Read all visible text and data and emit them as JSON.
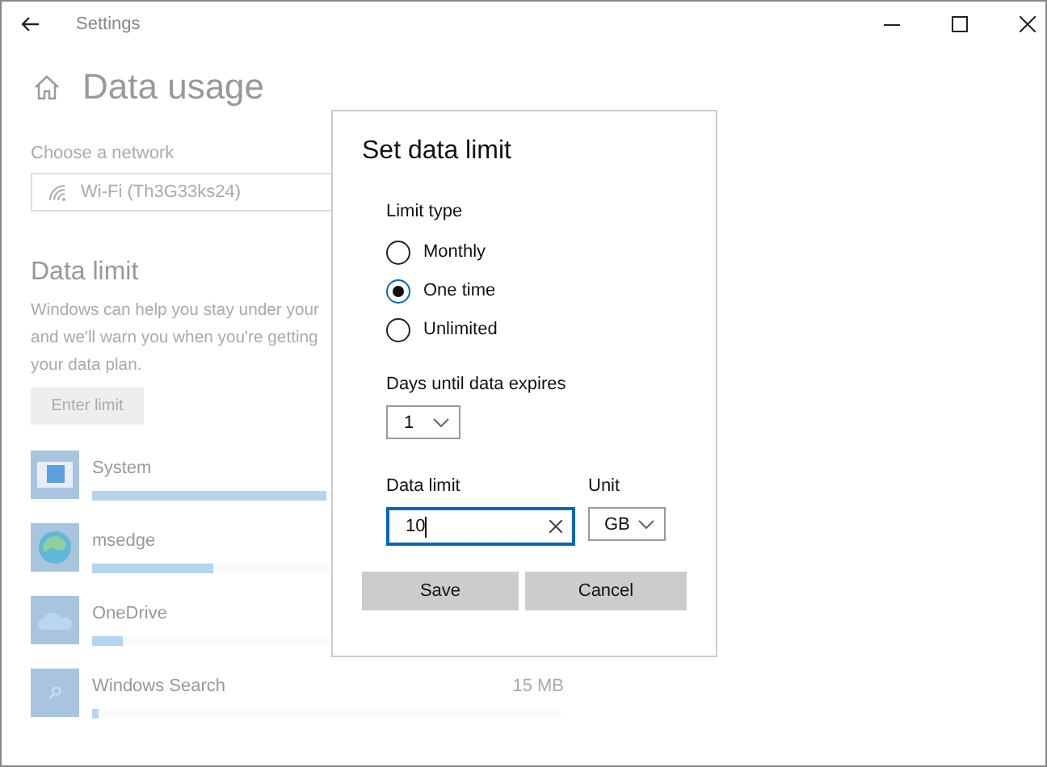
{
  "window": {
    "title": "Settings"
  },
  "page": {
    "title": "Data usage"
  },
  "network": {
    "label": "Choose a network",
    "value": "Wi-Fi (Th3G33ks24)"
  },
  "data_limit": {
    "heading": "Data limit",
    "description": "Windows can help you stay under your\nand we'll warn you when you're getting\nyour data plan.",
    "button": "Enter limit"
  },
  "apps": [
    {
      "name": "System",
      "kind": "system",
      "level": 0.5
    },
    {
      "name": "msedge",
      "kind": "edge",
      "level": 0.26
    },
    {
      "name": "OneDrive",
      "kind": "onedrive",
      "level": 0.066
    },
    {
      "name": "Windows Search",
      "kind": "search",
      "level": 0.014,
      "usage": "15 MB"
    }
  ],
  "dialog": {
    "title": "Set data limit",
    "limit_type_label": "Limit type",
    "limit_types": [
      {
        "label": "Monthly",
        "selected": false
      },
      {
        "label": "One time",
        "selected": true
      },
      {
        "label": "Unlimited",
        "selected": false
      }
    ],
    "days_label": "Days until data expires",
    "days_value": "1",
    "data_limit_label": "Data limit",
    "data_limit_value": "10",
    "unit_label": "Unit",
    "unit_value": "GB",
    "buttons": [
      "Save",
      "Cancel"
    ]
  }
}
